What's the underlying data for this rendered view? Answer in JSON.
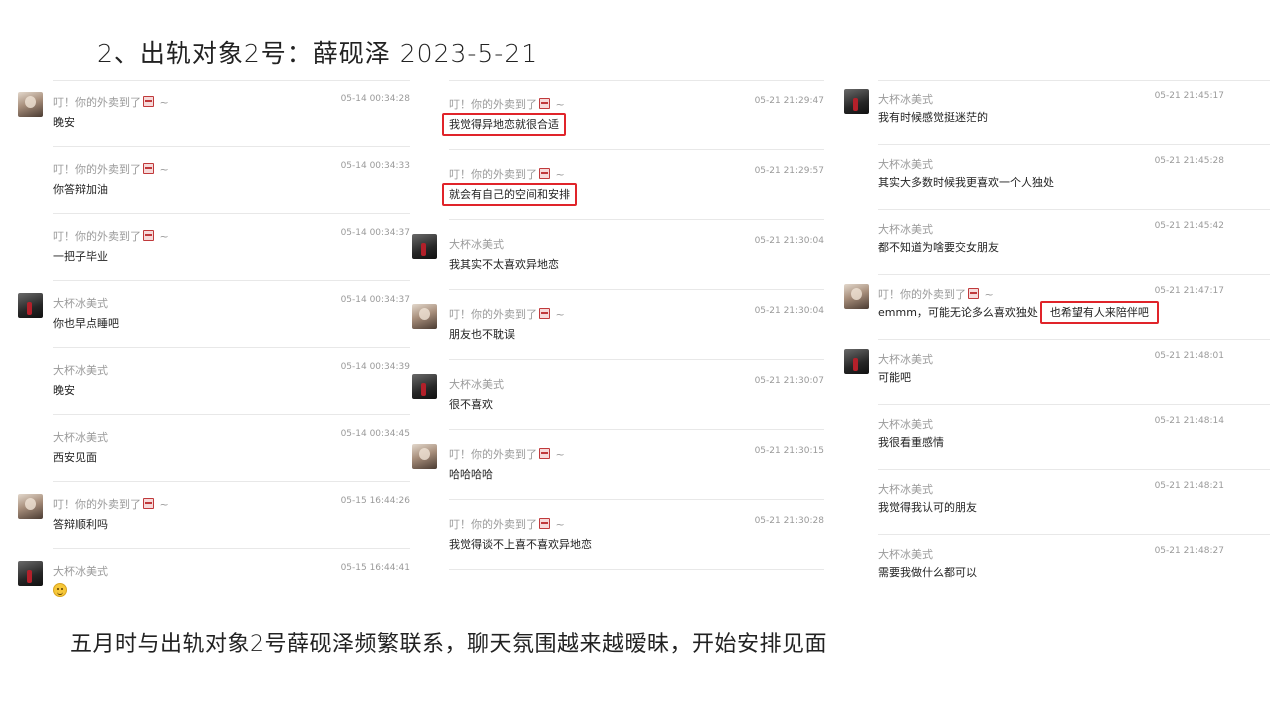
{
  "title": "2、出轨对象2号：薛砚泽 2023-5-21",
  "caption": "五月时与出轨对象2号薛砚泽频繁联系，聊天氛围越来越暧昧，开始安排见面",
  "colors": {
    "highlight": "#e0242a",
    "meta_text": "#9a9a9a"
  },
  "sender_her": "叮！你的外卖到了",
  "sender_him": "大杯冰美式",
  "sender_suffix": "~",
  "columns": [
    {
      "messages": [
        {
          "avatar": "her",
          "sender": "叮！你的外卖到了",
          "time": "05-14 00:34:28",
          "text": "晚安"
        },
        {
          "avatar": "",
          "sender": "叮！你的外卖到了",
          "time": "05-14 00:34:33",
          "text": "你答辩加油"
        },
        {
          "avatar": "",
          "sender": "叮！你的外卖到了",
          "time": "05-14 00:34:37",
          "text": "一把子毕业"
        },
        {
          "avatar": "him",
          "sender": "大杯冰美式",
          "time": "05-14 00:34:37",
          "text": "你也早点睡吧"
        },
        {
          "avatar": "",
          "sender": "大杯冰美式",
          "time": "05-14 00:34:39",
          "text": "晚安"
        },
        {
          "avatar": "",
          "sender": "大杯冰美式",
          "time": "05-14 00:34:45",
          "text": "西安见面"
        },
        {
          "avatar": "her",
          "sender": "叮！你的外卖到了",
          "time": "05-15 16:44:26",
          "text": "答辩顺利吗"
        },
        {
          "avatar": "him",
          "sender": "大杯冰美式",
          "time": "05-15 16:44:41",
          "text": ""
        }
      ]
    },
    {
      "messages": [
        {
          "avatar": "",
          "sender": "叮！你的外卖到了",
          "time": "05-21 21:29:47",
          "text": "我觉得异地恋就很合适"
        },
        {
          "avatar": "",
          "sender": "叮！你的外卖到了",
          "time": "05-21 21:29:57",
          "text": "就会有自己的空间和安排"
        },
        {
          "avatar": "him",
          "sender": "大杯冰美式",
          "time": "05-21 21:30:04",
          "text": "我其实不太喜欢异地恋"
        },
        {
          "avatar": "her",
          "sender": "叮！你的外卖到了",
          "time": "05-21 21:30:04",
          "text": "朋友也不耽误"
        },
        {
          "avatar": "him",
          "sender": "大杯冰美式",
          "time": "05-21 21:30:07",
          "text": "很不喜欢"
        },
        {
          "avatar": "her",
          "sender": "叮！你的外卖到了",
          "time": "05-21 21:30:15",
          "text": "哈哈哈哈"
        },
        {
          "avatar": "",
          "sender": "叮！你的外卖到了",
          "time": "05-21 21:30:28",
          "text": "我觉得谈不上喜不喜欢异地恋"
        }
      ]
    },
    {
      "messages": [
        {
          "avatar": "him",
          "sender": "大杯冰美式",
          "time": "05-21 21:45:17",
          "text": "我有时候感觉挺迷茫的"
        },
        {
          "avatar": "",
          "sender": "大杯冰美式",
          "time": "05-21 21:45:28",
          "text": "其实大多数时候我更喜欢一个人独处"
        },
        {
          "avatar": "",
          "sender": "大杯冰美式",
          "time": "05-21 21:45:42",
          "text": "都不知道为啥要交女朋友"
        },
        {
          "avatar": "her",
          "sender": "叮！你的外卖到了",
          "time": "05-21 21:47:17",
          "text": "emmm，可能无论多么喜欢独处",
          "text_highlight": "也希望有人来陪伴吧"
        },
        {
          "avatar": "him",
          "sender": "大杯冰美式",
          "time": "05-21 21:48:01",
          "text": "可能吧"
        },
        {
          "avatar": "",
          "sender": "大杯冰美式",
          "time": "05-21 21:48:14",
          "text": "我很看重感情"
        },
        {
          "avatar": "",
          "sender": "大杯冰美式",
          "time": "05-21 21:48:21",
          "text": "我觉得我认可的朋友"
        },
        {
          "avatar": "",
          "sender": "大杯冰美式",
          "time": "05-21 21:48:27",
          "text": "需要我做什么都可以"
        }
      ]
    }
  ]
}
